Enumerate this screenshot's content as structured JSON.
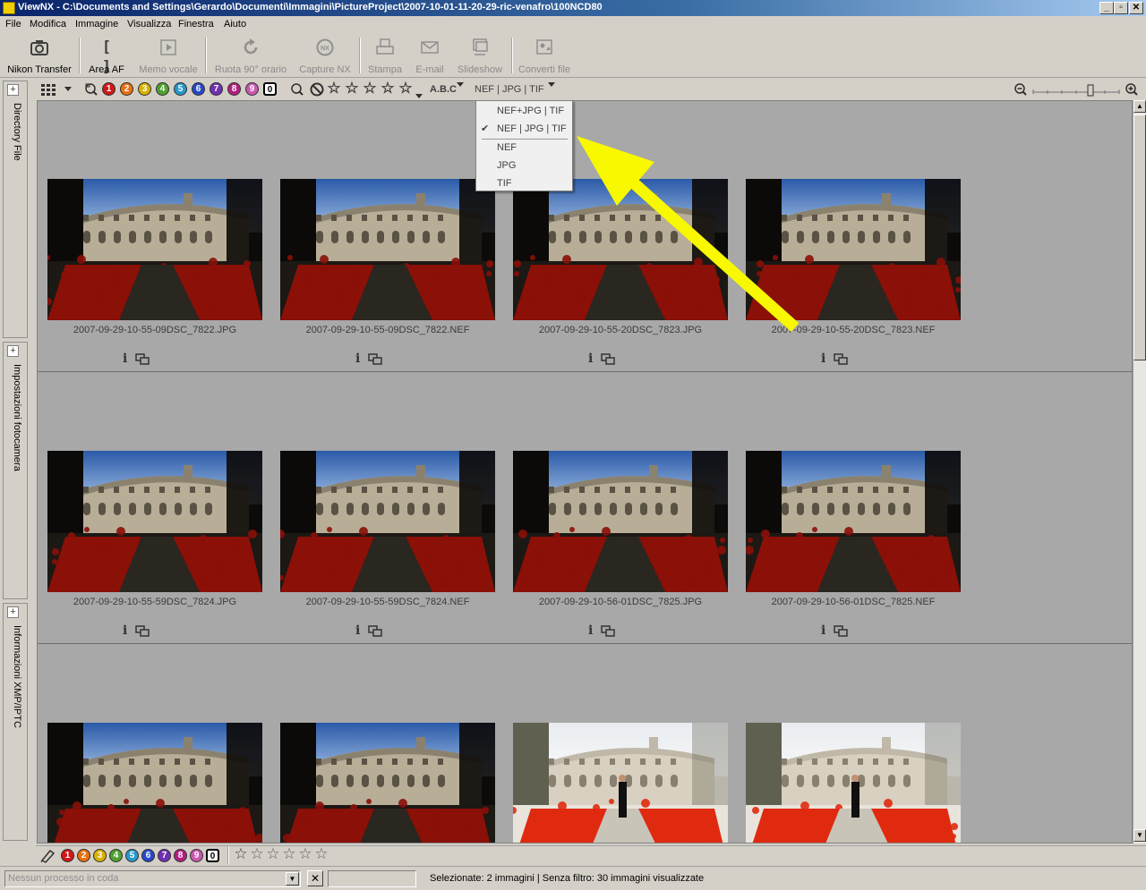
{
  "window": {
    "title": "ViewNX - C:\\Documents and Settings\\Gerardo\\Documenti\\Immagini\\PictureProject\\2007-10-01-11-20-29-ric-venafro\\100NCD80",
    "buttons": {
      "minimize": "_",
      "maximize": "▫",
      "close": "✕"
    }
  },
  "menu": [
    "File",
    "Modifica",
    "Immagine",
    "Visualizza",
    "Finestra",
    "Aiuto"
  ],
  "toolbar": [
    {
      "label": "Nikon Transfer",
      "icon": "camera-icon",
      "enabled": true
    },
    {
      "label": "Area AF",
      "icon": "af-area-icon",
      "enabled": true
    },
    {
      "label": "Memo vocale",
      "icon": "voice-memo-icon",
      "enabled": false
    },
    {
      "label": "Ruota 90° orario",
      "icon": "rotate-cw-icon",
      "enabled": false
    },
    {
      "label": "Capture NX",
      "icon": "capture-nx-icon",
      "enabled": false
    },
    {
      "label": "Stampa",
      "icon": "print-icon",
      "enabled": false
    },
    {
      "label": "E-mail",
      "icon": "email-icon",
      "enabled": false
    },
    {
      "label": "Slideshow",
      "icon": "slideshow-icon",
      "enabled": false
    },
    {
      "label": "Converti file",
      "icon": "convert-file-icon",
      "enabled": false
    }
  ],
  "side_panels": [
    "Directory File",
    "Impostazioni fotocamera",
    "Informazioni XMP/IPTC"
  ],
  "filter_bar": {
    "labels": [
      "1",
      "2",
      "3",
      "4",
      "5",
      "6",
      "7",
      "8",
      "9",
      "0"
    ],
    "label_colors": [
      "#d01818",
      "#e87010",
      "#d8b000",
      "#50a030",
      "#2898c8",
      "#2848c8",
      "#7030b0",
      "#b02080",
      "#c858b0",
      "#ffffff"
    ],
    "sort_label": "A.B.C",
    "format_label": "NEF | JPG | TIF"
  },
  "format_menu": {
    "items": [
      {
        "label": "NEF+JPG  |  TIF",
        "checked": false
      },
      {
        "label": "NEF | JPG  |  TIF",
        "checked": true
      },
      {
        "label": "NEF",
        "checked": false
      },
      {
        "label": "JPG",
        "checked": false
      },
      {
        "label": "TIF",
        "checked": false
      }
    ],
    "check_mark": "✔"
  },
  "thumbnails": [
    {
      "filename": "2007-09-29-10-55-09DSC_7822.JPG",
      "exposure": "dark"
    },
    {
      "filename": "2007-09-29-10-55-09DSC_7822.NEF",
      "exposure": "dark"
    },
    {
      "filename": "2007-09-29-10-55-20DSC_7823.JPG",
      "exposure": "dark"
    },
    {
      "filename": "2007-09-29-10-55-20DSC_7823.NEF",
      "exposure": "dark"
    },
    {
      "filename": "2007-09-29-10-55-59DSC_7824.JPG",
      "exposure": "dark"
    },
    {
      "filename": "2007-09-29-10-55-59DSC_7824.NEF",
      "exposure": "dark"
    },
    {
      "filename": "2007-09-29-10-56-01DSC_7825.JPG",
      "exposure": "dark"
    },
    {
      "filename": "2007-09-29-10-56-01DSC_7825.NEF",
      "exposure": "dark"
    },
    {
      "filename": "",
      "exposure": "dark"
    },
    {
      "filename": "",
      "exposure": "dark"
    },
    {
      "filename": "",
      "exposure": "bright"
    },
    {
      "filename": "",
      "exposure": "bright"
    }
  ],
  "cell_info_glyph": "i",
  "status": {
    "queue_placeholder": "Nessun processo in coda",
    "cancel_glyph": "✕",
    "summary": "Selezionate: 2 immagini | Senza filtro: 30 immagini visualizzate"
  },
  "colors": {
    "annotation_arrow": "#f8f800",
    "grid_background": "#a8a8a8"
  }
}
